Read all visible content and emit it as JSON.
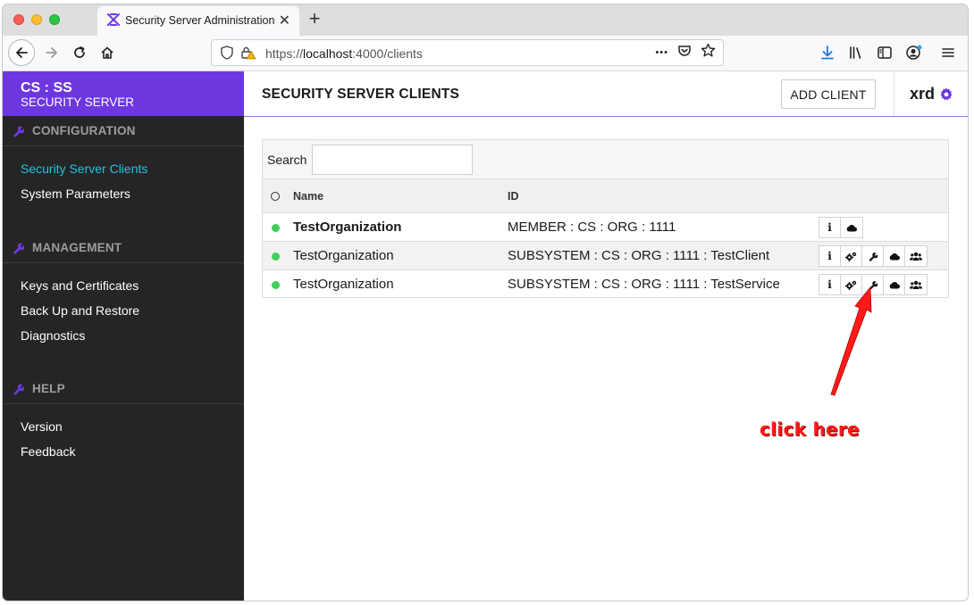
{
  "browser": {
    "tab_title": "Security Server Administration",
    "close_glyph": "✕",
    "newtab_glyph": "+",
    "url_prefix": "https://",
    "url_host": "localhost",
    "url_path": ":4000/clients",
    "url_more_glyph": "•••"
  },
  "app": {
    "brand_title": "CS : SS",
    "brand_subtitle": "SECURITY SERVER",
    "page_title": "SECURITY SERVER CLIENTS",
    "add_client_label": "ADD CLIENT",
    "username": "xrd",
    "accent_color": "#6d37e0",
    "active_link_color": "#24c2e2"
  },
  "sidebar": {
    "sections": [
      {
        "title": "CONFIGURATION",
        "items": [
          "Security Server Clients",
          "System Parameters"
        ]
      },
      {
        "title": "MANAGEMENT",
        "items": [
          "Keys and Certificates",
          "Back Up and Restore",
          "Diagnostics"
        ]
      },
      {
        "title": "HELP",
        "items": [
          "Version",
          "Feedback"
        ]
      }
    ],
    "active_item": "Security Server Clients"
  },
  "table": {
    "search_label": "Search",
    "search_value": "",
    "columns": {
      "name": "Name",
      "id": "ID"
    },
    "rows": [
      {
        "name": "TestOrganization",
        "id": "MEMBER : CS : ORG : 1111",
        "status": "green",
        "actions": [
          "info-icon",
          "cloud-icon"
        ]
      },
      {
        "name": "TestOrganization",
        "id": "SUBSYSTEM : CS : ORG : 1111 : TestClient",
        "status": "green",
        "actions": [
          "info-icon",
          "cogs-icon",
          "wrench-icon",
          "cloud-icon",
          "users-icon"
        ]
      },
      {
        "name": "TestOrganization",
        "id": "SUBSYSTEM : CS : ORG : 1111 : TestService",
        "status": "green",
        "actions": [
          "info-icon",
          "cogs-icon",
          "wrench-icon",
          "cloud-icon",
          "users-icon"
        ]
      }
    ],
    "info_glyph": "i"
  },
  "annotation": {
    "text": "click here",
    "color": "#ff1a1a"
  }
}
